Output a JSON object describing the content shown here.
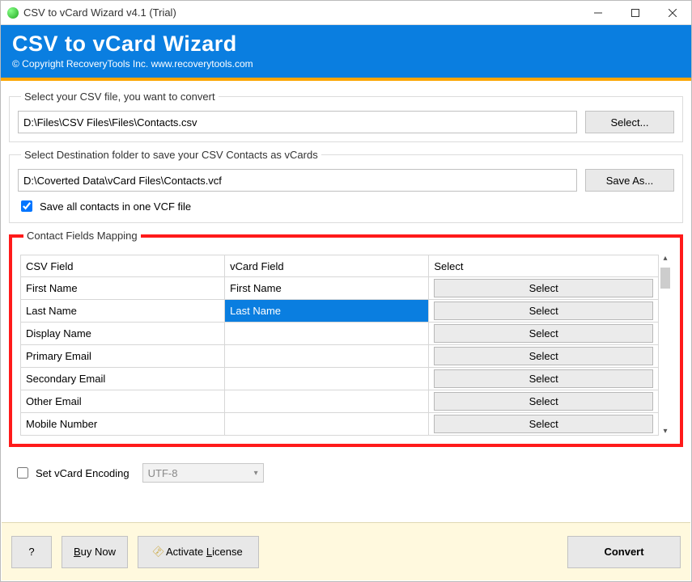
{
  "window": {
    "title": "CSV to vCard Wizard v4.1 (Trial)"
  },
  "banner": {
    "title": "CSV to vCard Wizard",
    "copyright": "© Copyright RecoveryTools Inc. www.recoverytools.com"
  },
  "source": {
    "legend": "Select your CSV file, you want to convert",
    "path": "D:\\Files\\CSV Files\\Files\\Contacts.csv",
    "select_label": "Select..."
  },
  "dest": {
    "legend": "Select Destination folder to save your CSV Contacts as vCards",
    "path": "D:\\Coverted Data\\vCard Files\\Contacts.vcf",
    "saveas_label": "Save As...",
    "save_all_label": "Save all contacts in one VCF file",
    "save_all_checked": true
  },
  "mapping": {
    "legend": "Contact Fields Mapping",
    "headers": {
      "csv": "CSV Field",
      "vcard": "vCard Field",
      "select": "Select"
    },
    "select_btn_label": "Select",
    "rows": [
      {
        "csv": "First Name",
        "vcard": "First Name",
        "highlight": false
      },
      {
        "csv": "Last Name",
        "vcard": "Last Name",
        "highlight": true
      },
      {
        "csv": "Display Name",
        "vcard": "",
        "highlight": false
      },
      {
        "csv": "Primary Email",
        "vcard": "",
        "highlight": false
      },
      {
        "csv": "Secondary Email",
        "vcard": "",
        "highlight": false
      },
      {
        "csv": "Other Email",
        "vcard": "",
        "highlight": false
      },
      {
        "csv": "Mobile Number",
        "vcard": "",
        "highlight": false
      }
    ]
  },
  "encoding": {
    "label": "Set vCard Encoding",
    "value": "UTF-8",
    "checked": false
  },
  "footer": {
    "help": "?",
    "buy": "Buy Now",
    "activate": "Activate License",
    "convert": "Convert"
  }
}
